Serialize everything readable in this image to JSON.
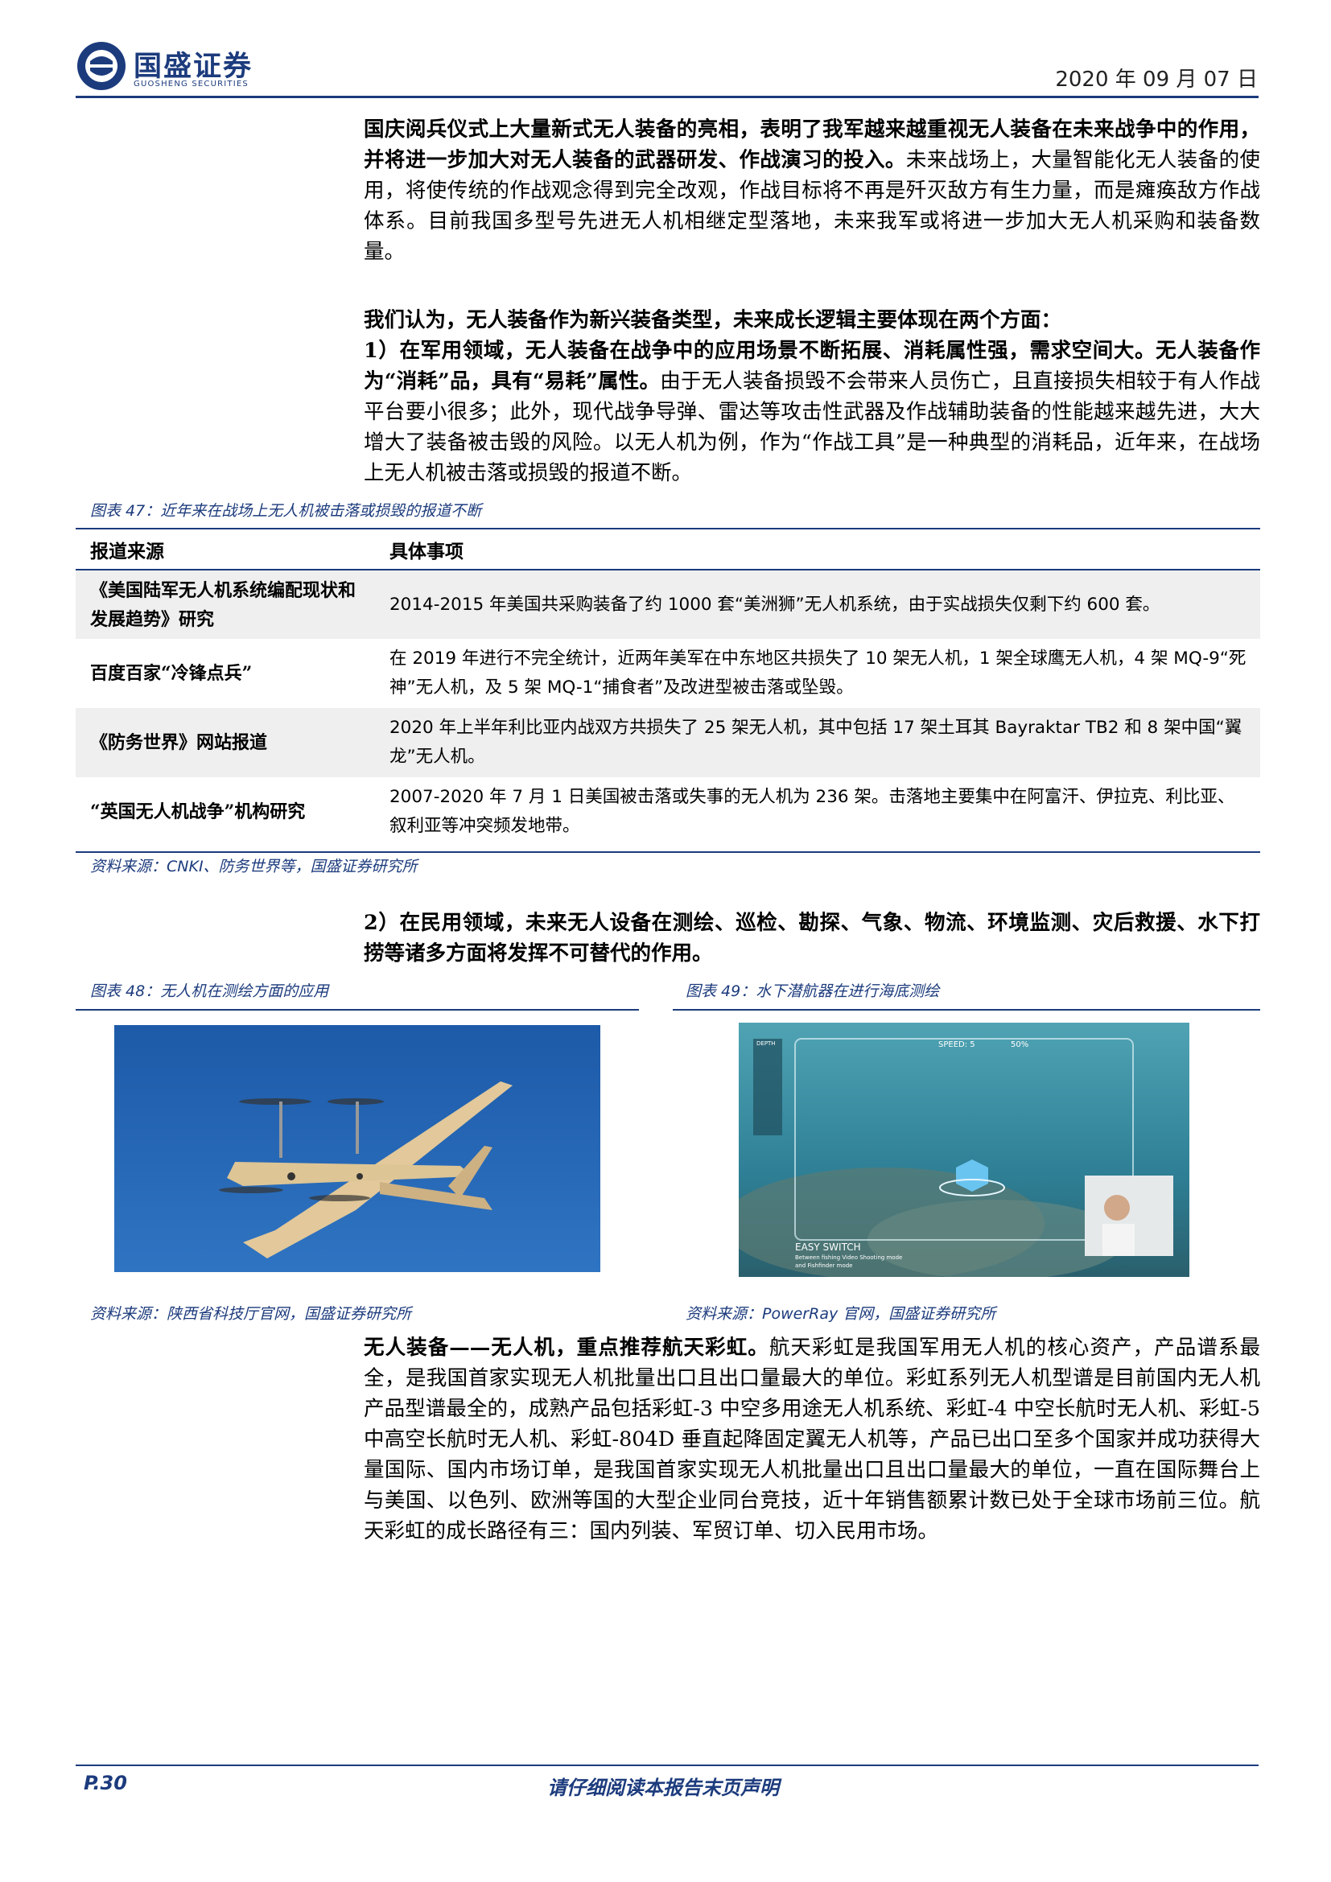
{
  "header": {
    "brand_cn": "国盛证券",
    "brand_en": "GUOSHENG SECURITIES",
    "date": "2020 年 09 月 07 日",
    "brand_color": "#1c3b7d"
  },
  "para1": {
    "bold": "国庆阅兵仪式上大量新式无人装备的亮相，表明了我军越来越重视无人装备在未来战争中的作用，并将进一步加大对无人装备的武器研发、作战演习的投入。",
    "rest": "未来战场上，大量智能化无人装备的使用，将使传统的作战观念得到完全改观，作战目标将不再是歼灭敌方有生力量，而是瘫痪敌方作战体系。目前我国多型号先进无人机相继定型落地，未来我军或将进一步加大无人机采购和装备数量。"
  },
  "para2": {
    "bold": "我们认为，无人装备作为新兴装备类型，未来成长逻辑主要体现在两个方面："
  },
  "para3": {
    "bold": "1）在军用领域，无人装备在战争中的应用场景不断拓展、消耗属性强，需求空间大。无人装备作为“消耗”品，具有“易耗”属性。",
    "rest": "由于无人装备损毁不会带来人员伤亡，且直接损失相较于有人作战平台要小很多；此外，现代战争导弹、雷达等攻击性武器及作战辅助装备的性能越来越先进，大大增大了装备被击毁的风险。以无人机为例，作为“作战工具”是一种典型的消耗品，近年来，在战场上无人机被击落或损毁的报道不断。"
  },
  "figure47": {
    "caption": "图表 47：近年来在战场上无人机被击落或损毁的报道不断",
    "columns": [
      "报道来源",
      "具体事项"
    ],
    "rows": [
      {
        "source": "《美国陆军无人机系统编配现状和发展趋势》研究",
        "detail": "2014-2015 年美国共采购装备了约 1000 套“美洲狮”无人机系统，由于实战损失仅剩下约 600 套。"
      },
      {
        "source": "百度百家“冷锋点兵”",
        "detail": "在 2019 年进行不完全统计，近两年美军在中东地区共损失了 10 架无人机，1 架全球鹰无人机，4 架 MQ-9“死神”无人机，及 5 架 MQ-1“捕食者”及改进型被击落或坠毁。"
      },
      {
        "source": "《防务世界》网站报道",
        "detail": "2020 年上半年利比亚内战双方共损失了 25 架无人机，其中包括 17 架土耳其 Bayraktar TB2 和 8 架中国“翼龙”无人机。"
      },
      {
        "source": "“英国无人机战争”机构研究",
        "detail": "2007-2020 年 7 月 1 日美国被击落或失事的无人机为 236 架。击落地主要集中在阿富汗、伊拉克、利比亚、叙利亚等冲突频发地带。"
      }
    ],
    "source_note": "资料来源：CNKI、防务世界等，国盛证券研究所"
  },
  "para4": {
    "bold": "2）在民用领域，未来无人设备在测绘、巡检、勘探、气象、物流、环境监测、灾后救援、水下打捞等诸多方面将发挥不可替代的作用。"
  },
  "figure48": {
    "caption": "图表 48：无人机在测绘方面的应用",
    "source_note": "资料来源：陕西省科技厅官网，国盛证券研究所"
  },
  "figure49": {
    "caption": "图表 49：水下潜航器在进行海底测绘",
    "source_note": "资料来源：PowerRay 官网，国盛证券研究所",
    "hud": {
      "speed": "SPEED: 5",
      "battery": "50%",
      "depth": "DEPTH",
      "mode_title": "EASY SWITCH",
      "mode_line1": "Between fishing Video Shooting mode",
      "mode_line2": "and Fishfinder mode"
    }
  },
  "para5": {
    "bold": "无人装备——无人机，重点推荐航天彩虹。",
    "rest": "航天彩虹是我国军用无人机的核心资产，产品谱系最全，是我国首家实现无人机批量出口且出口量最大的单位。彩虹系列无人机型谱是目前国内无人机产品型谱最全的，成熟产品包括彩虹-3 中空多用途无人机系统、彩虹-4 中空长航时无人机、彩虹-5 中高空长航时无人机、彩虹-804D 垂直起降固定翼无人机等，产品已出口至多个国家并成功获得大量国际、国内市场订单，是我国首家实现无人机批量出口且出口量最大的单位，一直在国际舞台上与美国、以色列、欧洲等国的大型企业同台竞技，近十年销售额累计数已处于全球市场前三位。航天彩虹的成长路径有三：国内列装、军贸订单、切入民用市场。"
  },
  "footer": {
    "page": "P.30",
    "disclaimer": "请仔细阅读本报告末页声明"
  }
}
